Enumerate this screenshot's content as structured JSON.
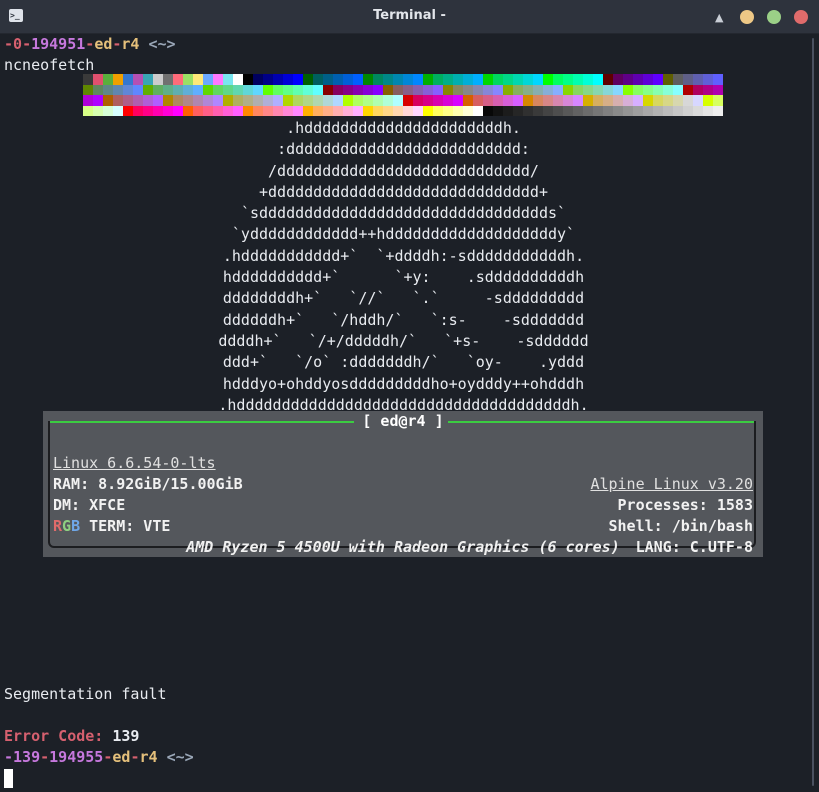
{
  "window": {
    "title": "Terminal -",
    "app_icon": ">_"
  },
  "prompt1": {
    "exit": "-0",
    "sep1": "-",
    "num": "194951",
    "sep2": "-",
    "user": "ed",
    "sep3": "-",
    "host": "r4",
    "dir": "<~>"
  },
  "command": "ncneofetch",
  "palette": [
    "#3a3a3a",
    "#e0506e",
    "#5aaf3c",
    "#f0a000",
    "#3477d0",
    "#b450b4",
    "#38a6b4",
    "#cccccc",
    "#707070",
    "#ff6b7a",
    "#9be064",
    "#ffe878",
    "#6ba8ff",
    "#ff78ff",
    "#78e6f0",
    "#ffffff",
    "#000000",
    "#00005f",
    "#000087",
    "#0000af",
    "#0000d7",
    "#0000ff",
    "#005f00",
    "#005f5f",
    "#005f87",
    "#005faf",
    "#005fd7",
    "#005fff",
    "#008700",
    "#00875f",
    "#008787",
    "#0087af",
    "#0087d7",
    "#0087ff",
    "#00af00",
    "#00af5f",
    "#00af87",
    "#00afaf",
    "#00afd7",
    "#00afff",
    "#00d700",
    "#00d75f",
    "#00d787",
    "#00d7af",
    "#00d7d7",
    "#00d7ff",
    "#00ff00",
    "#00ff5f",
    "#00ff87",
    "#00ffaf",
    "#00ffd7",
    "#00ffff",
    "#5f0000",
    "#5f005f",
    "#5f0087",
    "#5f00af",
    "#5f00d7",
    "#5f00ff",
    "#5f5f00",
    "#5f5f5f",
    "#5f5f87",
    "#5f5faf",
    "#5f5fd7",
    "#5f5fff",
    "#5f8700",
    "#5f875f",
    "#5f8787",
    "#5f87af",
    "#5f87d7",
    "#5f87ff",
    "#5faf00",
    "#5faf5f",
    "#5faf87",
    "#5fafaf",
    "#5fafd7",
    "#5fafff",
    "#5fd700",
    "#5fd75f",
    "#5fd787",
    "#5fd7af",
    "#5fd7d7",
    "#5fd7ff",
    "#5fff00",
    "#5fff5f",
    "#5fff87",
    "#5fffaf",
    "#5fffd7",
    "#5fffff",
    "#870000",
    "#87005f",
    "#870087",
    "#8700af",
    "#8700d7",
    "#8700ff",
    "#875f00",
    "#875f5f",
    "#875f87",
    "#875faf",
    "#875fd7",
    "#875fff",
    "#878700",
    "#87875f",
    "#878787",
    "#8787af",
    "#8787d7",
    "#8787ff",
    "#87af00",
    "#87af5f",
    "#87af87",
    "#87afaf",
    "#87afd7",
    "#87afff",
    "#87d700",
    "#87d75f",
    "#87d787",
    "#87d7af",
    "#87d7d7",
    "#87d7ff",
    "#87ff00",
    "#87ff5f",
    "#87ff87",
    "#87ffaf",
    "#87ffd7",
    "#87ffff",
    "#af0000",
    "#af005f",
    "#af0087",
    "#af00af",
    "#af00d7",
    "#af00ff",
    "#af5f00",
    "#af5f5f",
    "#af5f87",
    "#af5faf",
    "#af5fd7",
    "#af5fff",
    "#af8700",
    "#af875f",
    "#af8787",
    "#af87af",
    "#af87d7",
    "#af87ff",
    "#afaf00",
    "#afaf5f",
    "#afaf87",
    "#afafaf",
    "#afafd7",
    "#afafff",
    "#afd700",
    "#afd75f",
    "#afd787",
    "#afd7af",
    "#afd7d7",
    "#afd7ff",
    "#afff00",
    "#afff5f",
    "#afff87",
    "#afffaf",
    "#afffd7",
    "#afffff",
    "#d70000",
    "#d7005f",
    "#d70087",
    "#d700af",
    "#d700d7",
    "#d700ff",
    "#d75f00",
    "#d75f5f",
    "#d75f87",
    "#d75faf",
    "#d75fd7",
    "#d75fff",
    "#d78700",
    "#d7875f",
    "#d78787",
    "#d787af",
    "#d787d7",
    "#d787ff",
    "#d7af00",
    "#d7af5f",
    "#d7af87",
    "#d7afaf",
    "#d7afd7",
    "#d7afff",
    "#d7d700",
    "#d7d75f",
    "#d7d787",
    "#d7d7af",
    "#d7d7d7",
    "#d7d7ff",
    "#d7ff00",
    "#d7ff5f",
    "#d7ff87",
    "#d7ffaf",
    "#d7ffd7",
    "#d7ffff",
    "#ff0000",
    "#ff005f",
    "#ff0087",
    "#ff00af",
    "#ff00d7",
    "#ff00ff",
    "#ff5f00",
    "#ff5f5f",
    "#ff5f87",
    "#ff5faf",
    "#ff5fd7",
    "#ff5fff",
    "#ff8700",
    "#ff875f",
    "#ff8787",
    "#ff87af",
    "#ff87d7",
    "#ff87ff",
    "#ffaf00",
    "#ffaf5f",
    "#ffaf87",
    "#ffafaf",
    "#ffafd7",
    "#ffafff",
    "#ffd700",
    "#ffd75f",
    "#ffd787",
    "#ffd7af",
    "#ffd7d7",
    "#ffd7ff",
    "#ffff00",
    "#ffff5f",
    "#ffff87",
    "#ffffaf",
    "#ffffd7",
    "#ffffff",
    "#080808",
    "#121212",
    "#1c1c1c",
    "#262626",
    "#303030",
    "#3a3a3a",
    "#444444",
    "#4e4e4e",
    "#585858",
    "#626262",
    "#6c6c6c",
    "#767676",
    "#808080",
    "#8a8a8a",
    "#949494",
    "#9e9e9e",
    "#a8a8a8",
    "#b2b2b2",
    "#bcbcbc",
    "#c6c6c6",
    "#d0d0d0",
    "#dadada",
    "#e4e4e4",
    "#eeeeee"
  ],
  "logo_lines": [
    ".hddddddddddddddddddddddh.",
    ":dddddddddddddddddddddddddd:",
    "/dddddddddddddddddddddddddddd/",
    "+dddddddddddddddddddddddddddddd+",
    "`sdddddddddddddddddddddddddddddddds`",
    "`ydddddddddddd++hdddddddddddddddddddy`",
    ".hddddddddddd+`  `+ddddh:-sdddddddddddh.",
    "hdddddddddd+`      `+y:    .sddddddddddh",
    "ddddddddh+`   `//`   `.`     -sddddddddd",
    "ddddddh+`   `/hddh/`   `:s-    -sddddddd",
    "ddddh+`   `/+/dddddh/`   `+s-    -sdddddd",
    "ddd+`   `/o` :dddddddh/`   `oy-    .yddd",
    "hdddyo+ohddyosdddddddddho+oydddy++ohdddh",
    ".hdddddddddddddddddddddddddddddddddddddh."
  ],
  "info": {
    "title": "[ ed@r4 ]",
    "kernel": "Linux 6.6.54-0-lts",
    "distro": "Alpine Linux v3.20",
    "ram": "RAM: 8.92GiB/15.00GiB",
    "processes": "Processes: 1583",
    "dm": "DM: XFCE",
    "shell": "Shell: /bin/bash",
    "rgb": [
      "R",
      "G",
      "B"
    ],
    "term": " TERM: VTE",
    "lang": "LANG: C.UTF-8",
    "cpu": "AMD Ryzen 5 4500U with Radeon Graphics (6 cores)"
  },
  "output": {
    "segfault": "Segmentation fault",
    "error_label": "Error Code:",
    "error_value": "139"
  },
  "prompt2": {
    "exit": "-139",
    "sep1": "-",
    "num": "194955",
    "sep2": "-",
    "user": "ed",
    "sep3": "-",
    "host": "r4",
    "dir": "<~>"
  }
}
